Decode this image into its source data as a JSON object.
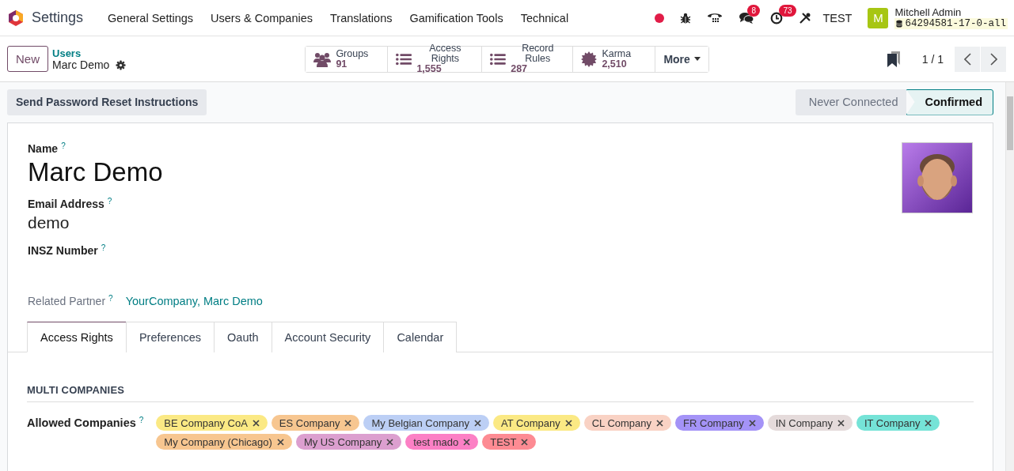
{
  "navbar": {
    "app": "Settings",
    "menus": [
      "General Settings",
      "Users & Companies",
      "Translations",
      "Gamification Tools",
      "Technical"
    ]
  },
  "systray": {
    "messages_badge": "8",
    "activities_badge": "73",
    "company": "TEST",
    "user": {
      "initial": "M",
      "name": "Mitchell Admin",
      "database": "64294581-17-0-all"
    }
  },
  "control_panel": {
    "new_button": "New",
    "breadcrumb": {
      "parent": "Users",
      "current": "Marc Demo"
    },
    "stat_buttons": [
      {
        "kind": "groups",
        "label": "Groups",
        "value": "91"
      },
      {
        "kind": "list",
        "label": "Access Rights",
        "value": "1,555"
      },
      {
        "kind": "list",
        "label": "Record Rules",
        "value": "287"
      },
      {
        "kind": "karma",
        "label": "Karma",
        "value": "2,510"
      }
    ],
    "more_button": "More",
    "pager": "1 / 1"
  },
  "action_button": "Send Password Reset Instructions",
  "stages": [
    {
      "label": "Never Connected",
      "selected": false
    },
    {
      "label": "Confirmed",
      "selected": true
    }
  ],
  "form": {
    "name": {
      "label": "Name",
      "help": "?",
      "value": "Marc Demo"
    },
    "email": {
      "label": "Email Address",
      "help": "?",
      "value": "demo"
    },
    "insz": {
      "label": "INSZ Number",
      "help": "?"
    },
    "related_partner": {
      "label": "Related Partner",
      "help": "?",
      "value": "YourCompany, Marc Demo"
    }
  },
  "tabs": [
    {
      "label": "Access Rights",
      "selected": true
    },
    {
      "label": "Preferences",
      "selected": false
    },
    {
      "label": "Oauth",
      "selected": false
    },
    {
      "label": "Account Security",
      "selected": false
    },
    {
      "label": "Calendar",
      "selected": false
    }
  ],
  "section": {
    "title": "MULTI COMPANIES"
  },
  "allowed_companies": {
    "label": "Allowed Companies",
    "help": "?",
    "tags": [
      {
        "label": "BE Company CoA",
        "color": "#fbe984"
      },
      {
        "label": "ES Company",
        "color": "#f7c690"
      },
      {
        "label": "My Belgian Company",
        "color": "#bccff5"
      },
      {
        "label": "AT Company",
        "color": "#fbe984"
      },
      {
        "label": "CL Company",
        "color": "#f9d2c4"
      },
      {
        "label": "FR Company",
        "color": "#a493f7"
      },
      {
        "label": "IN Company",
        "color": "#e5dbdb"
      },
      {
        "label": "IT Company",
        "color": "#75e3d7"
      },
      {
        "label": "My Company (Chicago)",
        "color": "#f7c690"
      },
      {
        "label": "My US Company",
        "color": "#dc9fcf"
      },
      {
        "label": "test mado",
        "color": "#fc80c5"
      },
      {
        "label": "TEST",
        "color": "#fd8b93"
      }
    ]
  }
}
